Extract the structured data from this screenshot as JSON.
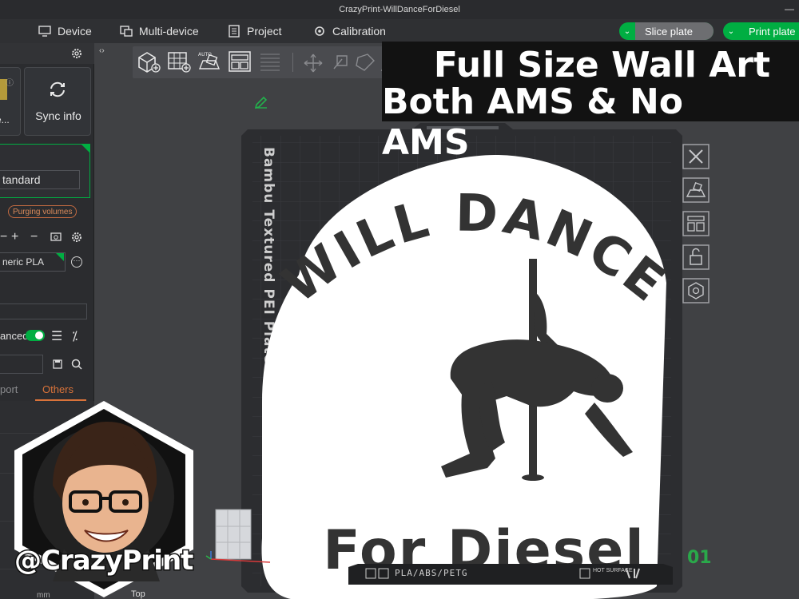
{
  "window": {
    "title": "CrazyPrint-WillDanceForDiesel"
  },
  "menu": {
    "device": "Device",
    "multi_device": "Multi-device",
    "project": "Project",
    "calibration": "Calibration",
    "slice_plate": "Slice plate",
    "print_plate": "Print plate"
  },
  "sidebar": {
    "card_left_label": "re...",
    "sync_info": "Sync info",
    "plate_type": "tandard",
    "purging_volumes": "Purging volumes",
    "filament": "neric PLA",
    "advanced_label": "anced",
    "tab_support": "port",
    "tab_others": "Others",
    "unit_label": "mm"
  },
  "canvas": {
    "bed_label": "Bambu Textured PEI Plate",
    "plate_info": "PLA/ABS/PETG",
    "hot_surface": "HOT SURFACE",
    "plate_number": "01",
    "view_label": "Top"
  },
  "artwork": {
    "line_top": "WILL DANCE",
    "line_bottom": "For Diesel"
  },
  "overlay": {
    "headline_1": "Full Size Wall Art",
    "headline_2": "Both AMS & No AMS",
    "handle": "@CrazyPrint"
  },
  "colors": {
    "accent_green": "#00ae42",
    "accent_orange": "#d9733a",
    "bed_dark": "#2c2d30",
    "art_white": "#ffffff",
    "art_ink": "#333333"
  }
}
